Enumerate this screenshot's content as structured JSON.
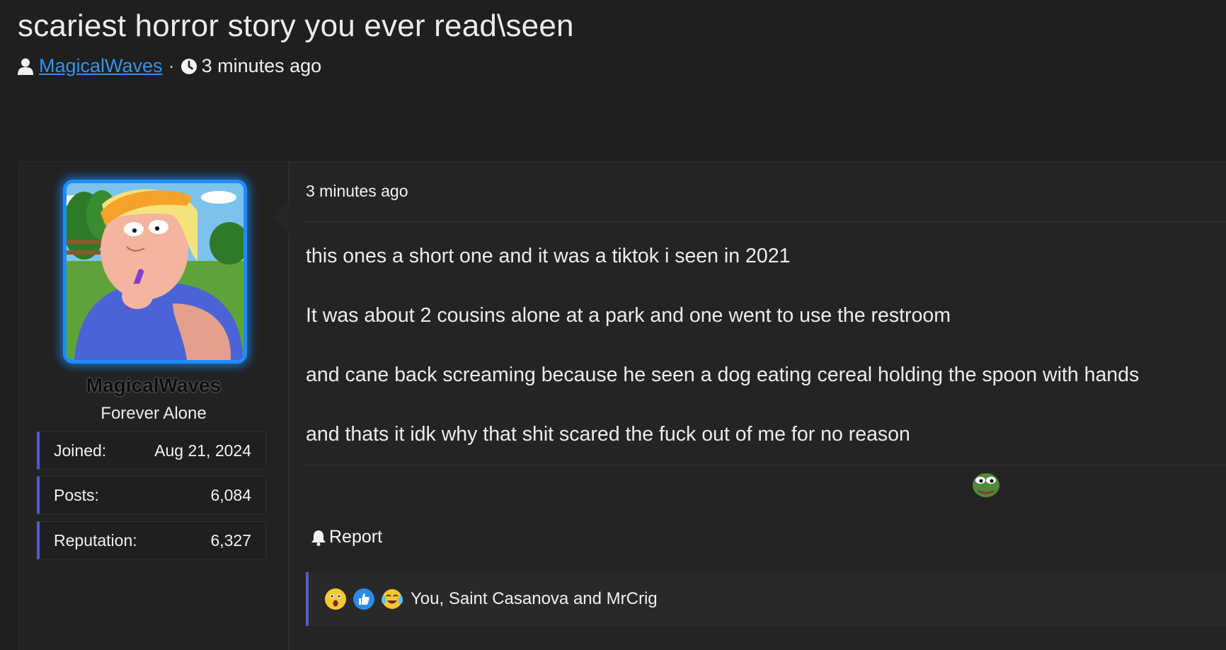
{
  "thread": {
    "title": "scariest horror story you ever read\\seen",
    "author": "MagicalWaves",
    "separator": "·",
    "time": "3 minutes ago"
  },
  "post": {
    "author": {
      "username": "MagicalWaves",
      "title": "Forever Alone",
      "stats": [
        {
          "label": "Joined:",
          "value": "Aug 21, 2024"
        },
        {
          "label": "Posts:",
          "value": "6,084"
        },
        {
          "label": "Reputation:",
          "value": "6,327"
        }
      ]
    },
    "time": "3 minutes ago",
    "paragraphs": [
      "this ones a short one and it was a tiktok i seen in 2021",
      "It was about 2 cousins alone at a park and one went to use the restroom",
      "and cane back screaming because he seen a dog eating cereal holding the spoon with hands",
      "and thats it idk why that shit scared the fuck out of me for no reason"
    ],
    "report_label": "Report",
    "reactions": {
      "icons": [
        "astonished-emoji",
        "thumbs-up-emoji",
        "crying-laughing-emoji"
      ],
      "text": "You, Saint Casanova and MrCrig"
    }
  },
  "colors": {
    "background": "#1f1f1f",
    "link": "#2f95f0",
    "avatar_glow": "#1c8cff",
    "accent_border": "#4f5bd5"
  }
}
